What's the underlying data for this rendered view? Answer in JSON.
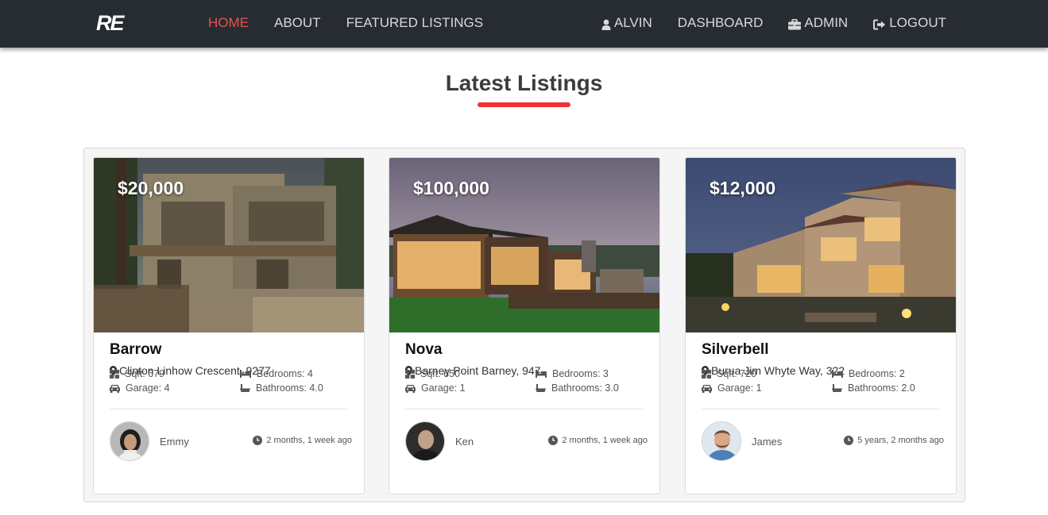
{
  "navbar": {
    "brand": "RE",
    "left_links": [
      {
        "label": "HOME",
        "active": true
      },
      {
        "label": "ABOUT",
        "active": false
      },
      {
        "label": "FEATURED LISTINGS",
        "active": false
      }
    ],
    "right_links": [
      {
        "label": "ALVIN",
        "icon": "user-icon"
      },
      {
        "label": "DASHBOARD",
        "icon": ""
      },
      {
        "label": "ADMIN",
        "icon": "briefcase-icon"
      },
      {
        "label": "LOGOUT",
        "icon": "logout-icon"
      }
    ]
  },
  "section": {
    "title": "Latest Listings",
    "accent_color": "#ee3333"
  },
  "listings": [
    {
      "price": "$20,000",
      "name": "Barrow",
      "address": "Clinton Linhow Crescent, 9277",
      "sqft": "Sqft: 679",
      "bedrooms": "Bedrooms: 4",
      "garage": "Garage: 4",
      "bathrooms": "Bathrooms: 4.0",
      "agent": "Emmy",
      "listed": "2 months, 1 week ago"
    },
    {
      "price": "$100,000",
      "name": "Nova",
      "address": "Barney Point Barney, 947",
      "sqft": "Sqft: 650",
      "bedrooms": "Bedrooms: 3",
      "garage": "Garage: 1",
      "bathrooms": "Bathrooms: 3.0",
      "agent": "Ken",
      "listed": "2 months, 1 week ago"
    },
    {
      "price": "$12,000",
      "name": "Silverbell",
      "address": "Burua Jim Whyte Way, 322",
      "sqft": "Sqft: 720",
      "bedrooms": "Bedrooms: 2",
      "garage": "Garage: 1",
      "bathrooms": "Bathrooms: 2.0",
      "agent": "James",
      "listed": "5 years, 2 months ago"
    }
  ]
}
